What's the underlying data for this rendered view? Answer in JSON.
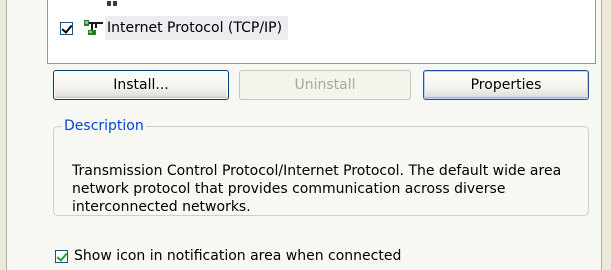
{
  "components_list": {
    "items": [
      {
        "label": "Internet Protocol (TCP/IP)",
        "checked": true,
        "icon": "network-protocol-icon"
      }
    ]
  },
  "buttons": {
    "install": "Install...",
    "uninstall": "Uninstall",
    "properties": "Properties"
  },
  "description": {
    "legend": "Description",
    "text": "Transmission Control Protocol/Internet Protocol. The default wide area network protocol that provides communication across diverse interconnected networks."
  },
  "options": {
    "show_icon_label": "Show icon in notification area when connected",
    "show_icon_checked": true
  },
  "colors": {
    "legend_text": "#0046d5",
    "check_green": "#21a121",
    "window_bg": "#ece9d8"
  }
}
